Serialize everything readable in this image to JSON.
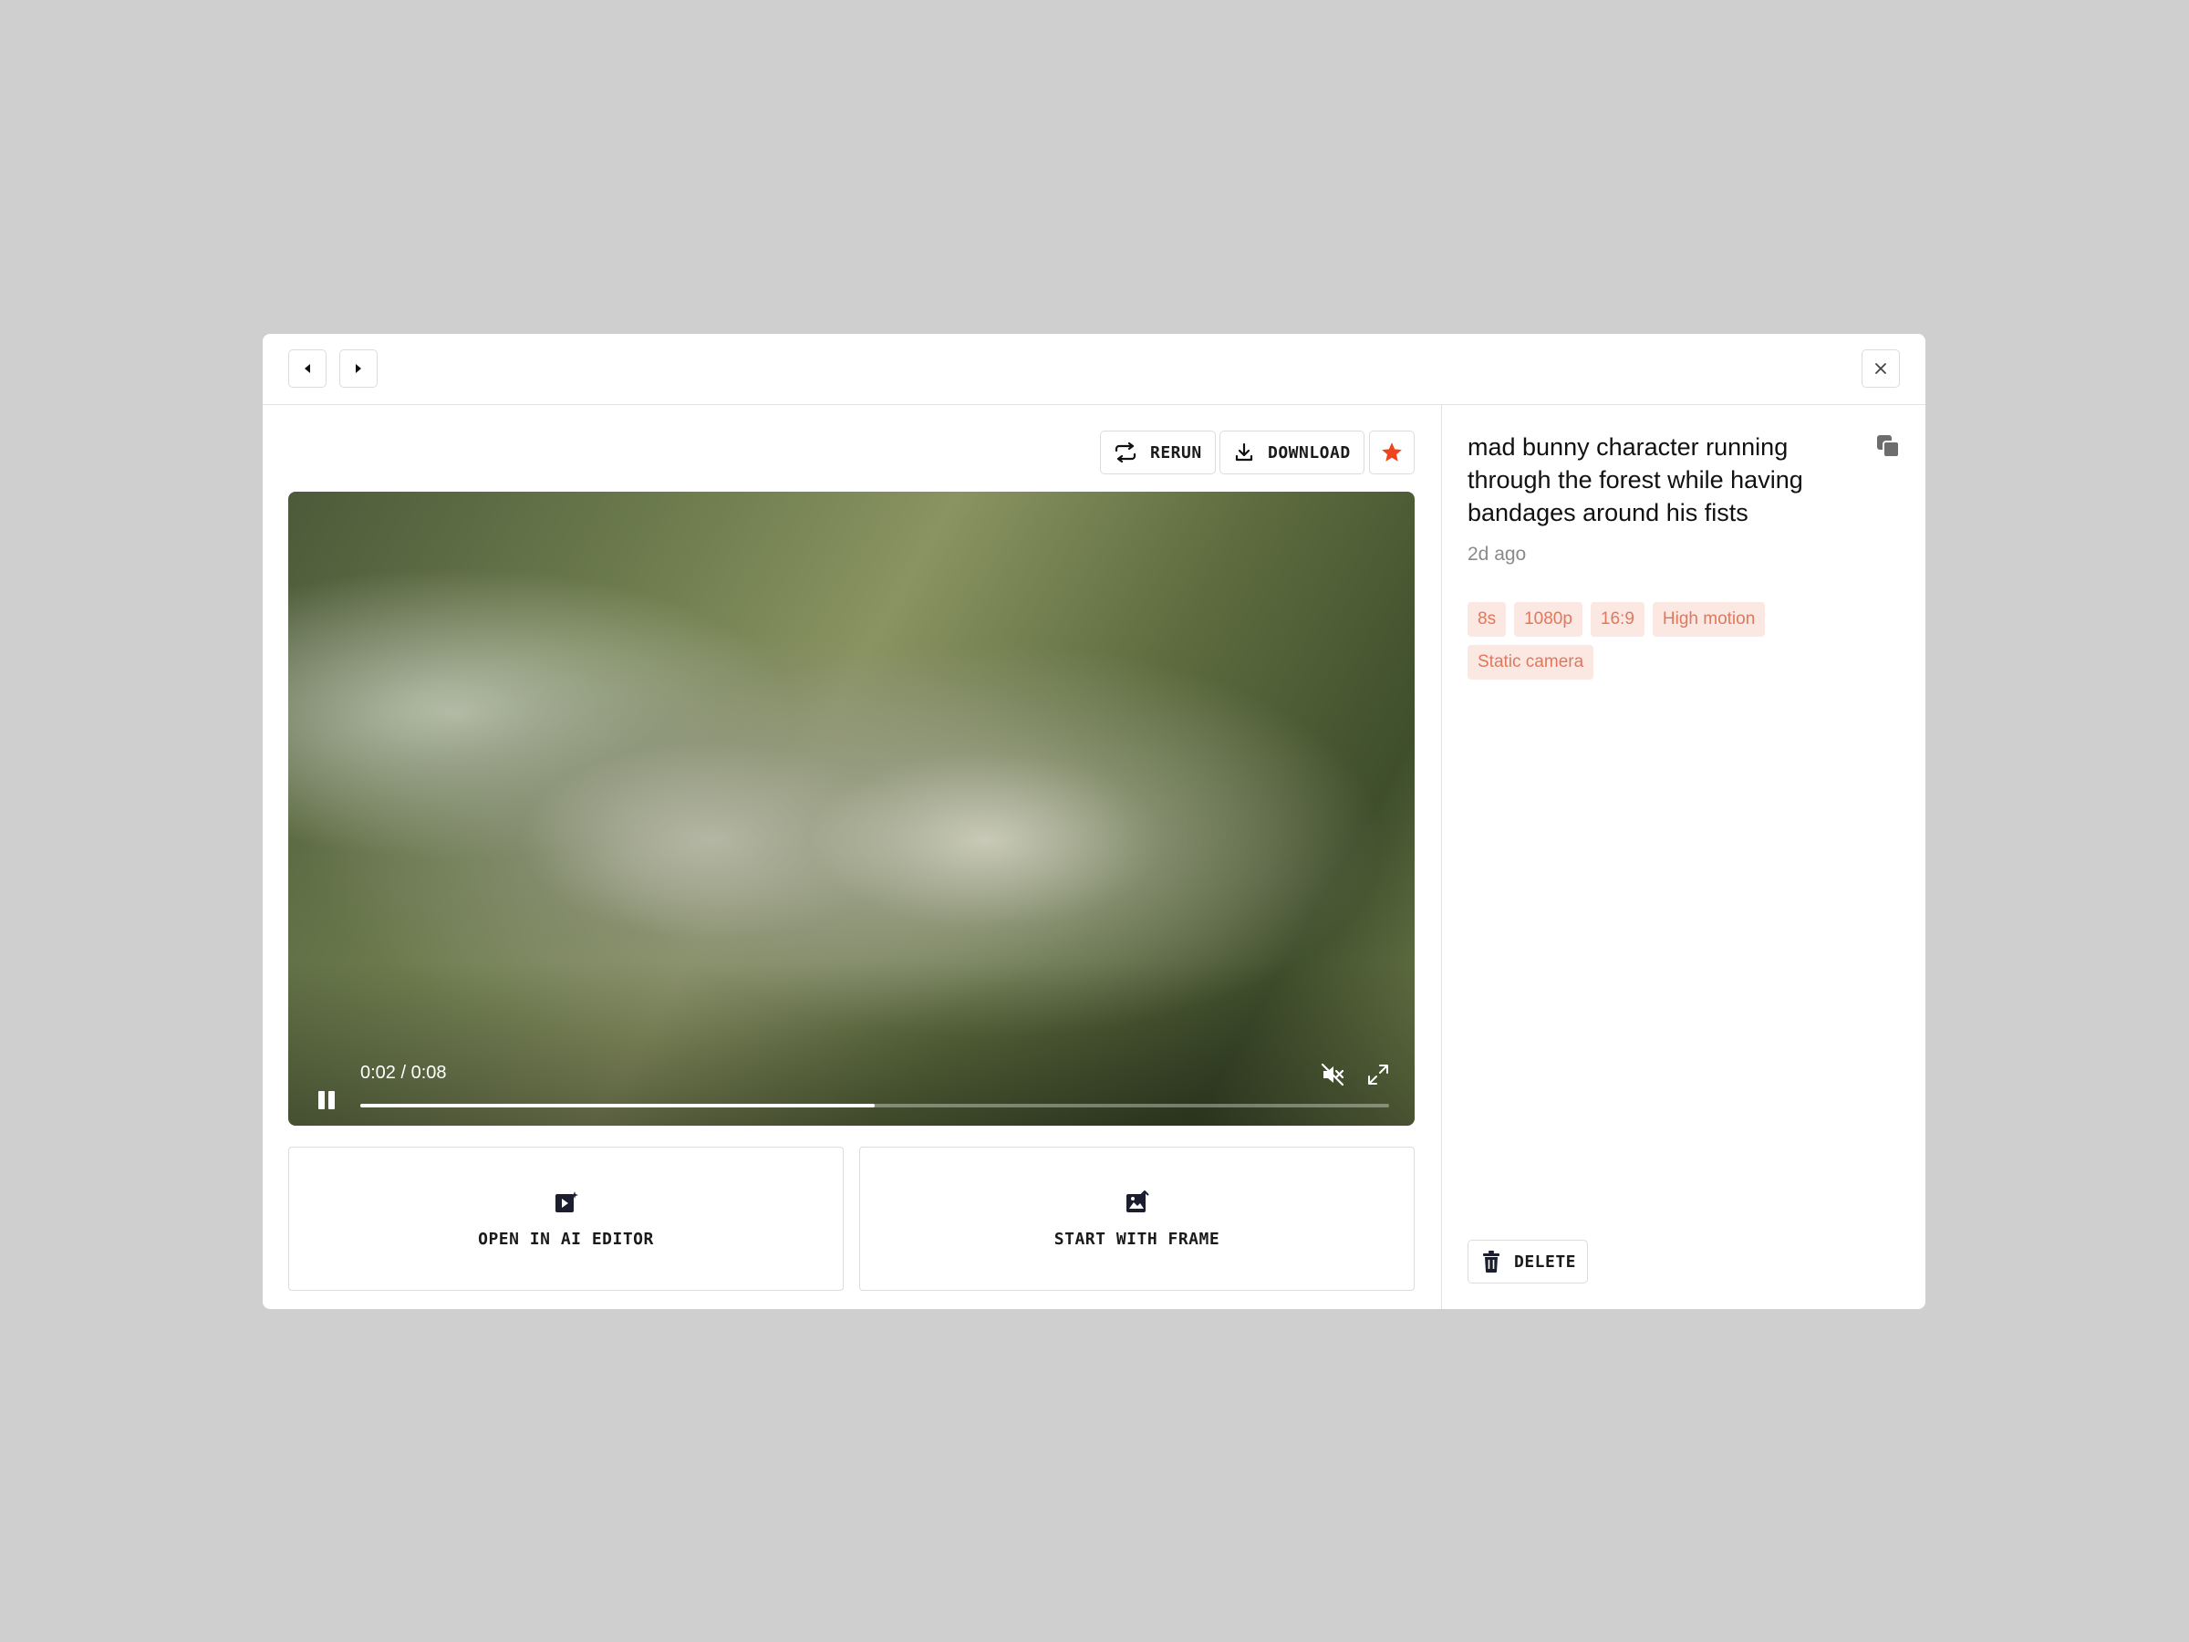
{
  "nav": {
    "prev_icon": "caret-left-icon",
    "next_icon": "caret-right-icon",
    "close_icon": "close-icon"
  },
  "toolbar": {
    "rerun_label": "RERUN",
    "download_label": "DOWNLOAD",
    "favorite_icon": "star-icon",
    "favorite_color": "#f0441c"
  },
  "video": {
    "time_display": "0:02 / 0:08",
    "progress": 0.5,
    "muted": true,
    "state": "playing"
  },
  "actions": {
    "open_editor_label": "OPEN IN AI EDITOR",
    "start_frame_label": "START WITH FRAME"
  },
  "details": {
    "prompt": "mad bunny character running through the forest while having bandages around his fists",
    "time_ago": "2d ago",
    "tags": [
      "8s",
      "1080p",
      "16:9",
      "High motion",
      "Static camera"
    ],
    "delete_label": "DELETE",
    "tag_bg": "#fbe8e2",
    "tag_color": "#e0785c"
  }
}
